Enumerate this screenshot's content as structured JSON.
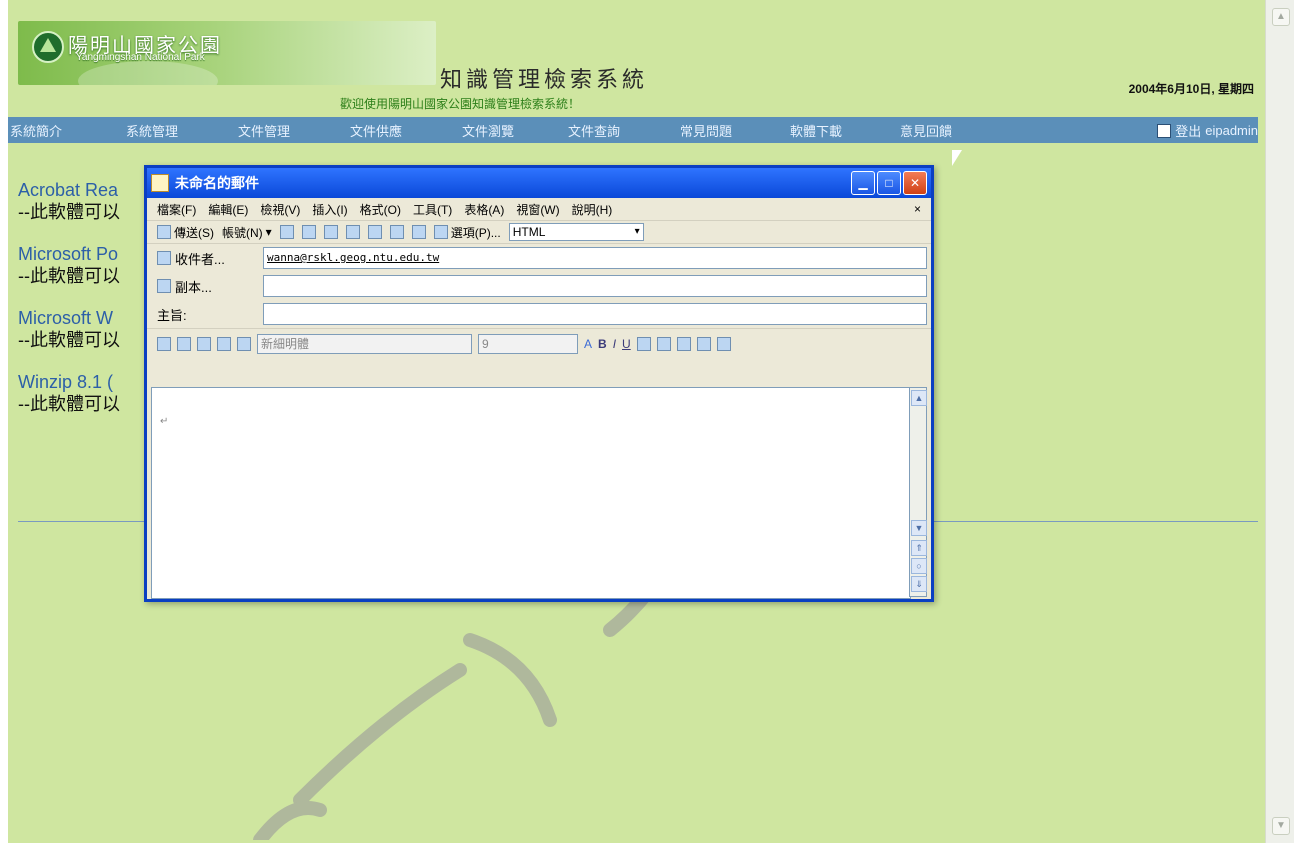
{
  "banner": {
    "logo_chinese": "陽明山國家公園",
    "logo_english": "Yangmingshan National Park"
  },
  "header": {
    "system_title": "知識管理檢索系統",
    "welcome": "歡迎使用陽明山國家公園知識管理檢索系統！",
    "date": "2004年6月10日, 星期四"
  },
  "nav": {
    "items": [
      "系統簡介",
      "系統管理",
      "文件管理",
      "文件供應",
      "文件瀏覽",
      "文件查詢",
      "常見問題",
      "軟體下載",
      "意見回饋"
    ],
    "logout_label": "登出",
    "username": "eipadmin"
  },
  "content": {
    "items": [
      {
        "title": "Acrobat Rea",
        "desc": "--此軟體可以"
      },
      {
        "title": "Microsoft Po",
        "desc": "--此軟體可以"
      },
      {
        "title": "Microsoft W",
        "desc": "--此軟體可以"
      },
      {
        "title": "Winzip 8.1 (",
        "desc": "--此軟體可以"
      }
    ]
  },
  "dialog": {
    "title": "未命名的郵件",
    "menu": [
      "檔案(F)",
      "編輯(E)",
      "檢視(V)",
      "插入(I)",
      "格式(O)",
      "工具(T)",
      "表格(A)",
      "視窗(W)",
      "說明(H)"
    ],
    "menu_close": "×",
    "toolbar": {
      "send": "傳送(S)",
      "account": "帳號(N)",
      "options": "選項(P)...",
      "format": "HTML"
    },
    "fields": {
      "to_label": "收件者...",
      "to_value": "wanna@rskl.geog.ntu.edu.tw",
      "cc_label": "副本...",
      "cc_value": "",
      "subject_label": "主旨:",
      "subject_value": ""
    },
    "format_bar": {
      "font": "新細明體",
      "size": "9",
      "bold": "B",
      "italic": "I",
      "underline": "U"
    },
    "editor_mark": "↵"
  },
  "colors": {
    "page_bg": "#cfe6a0",
    "nav_bg": "#5b8fb9",
    "dialog_title_bg": "#0a48d8",
    "link": "#2c5fa8"
  }
}
